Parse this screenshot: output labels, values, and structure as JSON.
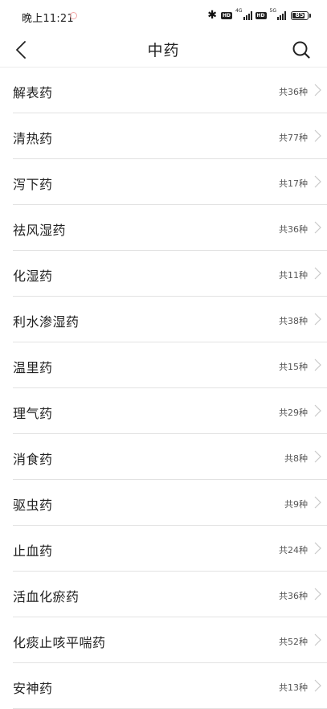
{
  "status_bar": {
    "time": "晚上11:21",
    "network_1": "4G",
    "network_2": "5G",
    "hd_label": "HD",
    "battery": "85",
    "battery_level": 0.85
  },
  "nav": {
    "title": "中药"
  },
  "items": [
    {
      "name": "解表药",
      "count": "共36种"
    },
    {
      "name": "清热药",
      "count": "共77种"
    },
    {
      "name": "泻下药",
      "count": "共17种"
    },
    {
      "name": "祛风湿药",
      "count": "共36种"
    },
    {
      "name": "化湿药",
      "count": "共11种"
    },
    {
      "name": "利水渗湿药",
      "count": "共38种"
    },
    {
      "name": "温里药",
      "count": "共15种"
    },
    {
      "name": "理气药",
      "count": "共29种"
    },
    {
      "name": "消食药",
      "count": "共8种"
    },
    {
      "name": "驱虫药",
      "count": "共9种"
    },
    {
      "name": "止血药",
      "count": "共24种"
    },
    {
      "name": "活血化瘀药",
      "count": "共36种"
    },
    {
      "name": "化痰止咳平喘药",
      "count": "共52种"
    },
    {
      "name": "安神药",
      "count": "共13种"
    }
  ]
}
